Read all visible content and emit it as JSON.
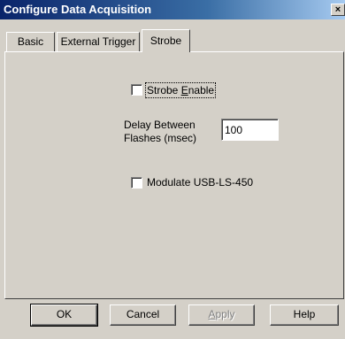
{
  "window": {
    "title": "Configure Data Acquisition",
    "close_glyph": "×"
  },
  "tabs": [
    {
      "label": "Basic"
    },
    {
      "label": "External Trigger"
    },
    {
      "label": "Strobe",
      "active": true
    }
  ],
  "strobe": {
    "enable_label": "Strobe Enable",
    "enable_checked": false,
    "delay_label_line1": "Delay Between",
    "delay_label_line2": "Flashes (msec)",
    "delay_value": "100",
    "modulate_label": "Modulate USB-LS-450",
    "modulate_checked": false
  },
  "buttons": {
    "ok": "OK",
    "cancel": "Cancel",
    "apply": "Apply",
    "help": "Help"
  }
}
